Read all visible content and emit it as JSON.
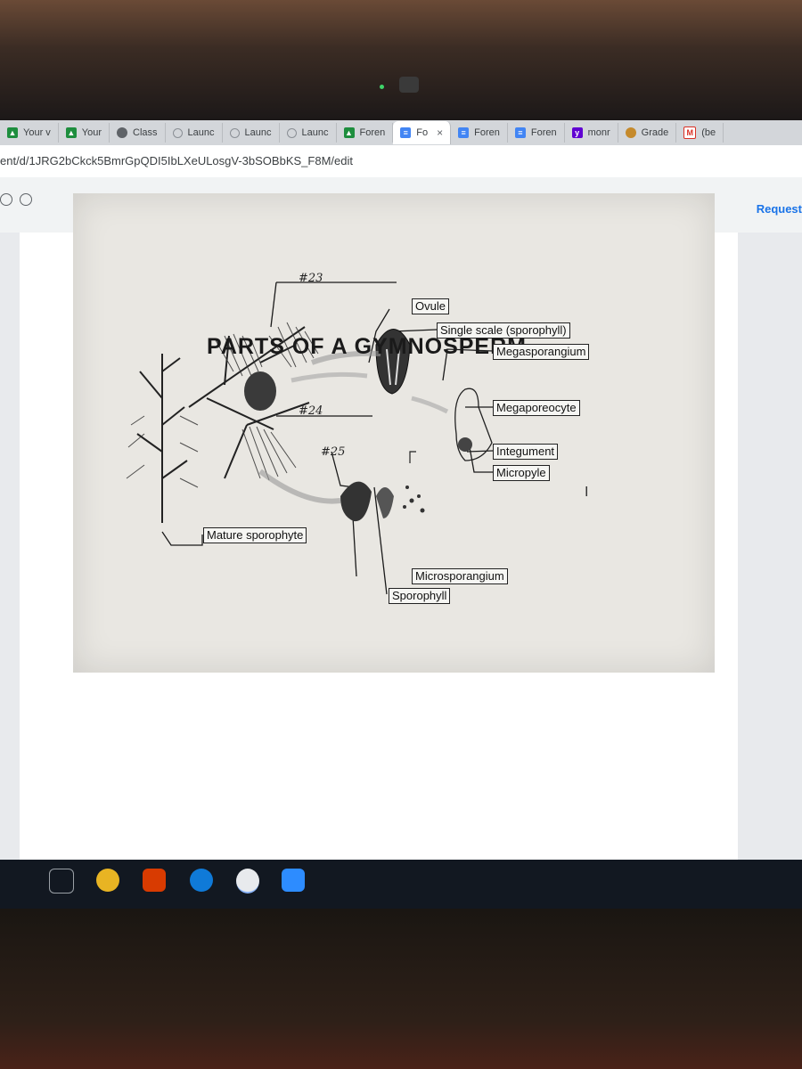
{
  "browser": {
    "tabs": [
      {
        "label": "Your v",
        "icon": "drive-icon"
      },
      {
        "label": "Your",
        "icon": "drive-icon"
      },
      {
        "label": "Class",
        "icon": "classroom-icon"
      },
      {
        "label": "Launc",
        "icon": "launch-icon"
      },
      {
        "label": "Launc",
        "icon": "launch-icon"
      },
      {
        "label": "Launc",
        "icon": "launch-icon"
      },
      {
        "label": "Foren",
        "icon": "drive-icon"
      },
      {
        "label": "Fo",
        "icon": "docs-icon"
      },
      {
        "label": "Foren",
        "icon": "docs-icon"
      },
      {
        "label": "Foren",
        "icon": "docs-icon"
      },
      {
        "label": "monr",
        "icon": "yahoo-icon"
      },
      {
        "label": "Grade",
        "icon": "grade-icon"
      },
      {
        "label": "(be",
        "icon": "gmail-icon"
      }
    ],
    "active_tab_close": "×",
    "url": "ent/d/1JRG2bCkck5BmrGpQDI5IbLXeULosgV-3bSOBbKS_F8M/edit"
  },
  "doc": {
    "request_label": "Request"
  },
  "slide": {
    "title": "PARTS OF A GYMNOSPERM",
    "labels": {
      "ovule": "Ovule",
      "single_scale": "Single scale (sporophyll)",
      "megasporangium": "Megasporangium",
      "megasporocyte": "Megaporeocyte",
      "integument": "Integument",
      "micropyle": "Micropyle",
      "mature_sporophyte": "Mature sporophyte",
      "microsporangium": "Microsporangium",
      "sporophyll": "Sporophyll"
    },
    "handwritten": {
      "n23": "#23",
      "n24": "#24",
      "n25": "#25"
    },
    "text_cursor": "I"
  },
  "colors": {
    "link_blue": "#1a73e8",
    "slide_bg": "#e9e7e2",
    "taskbar": "#121821"
  }
}
